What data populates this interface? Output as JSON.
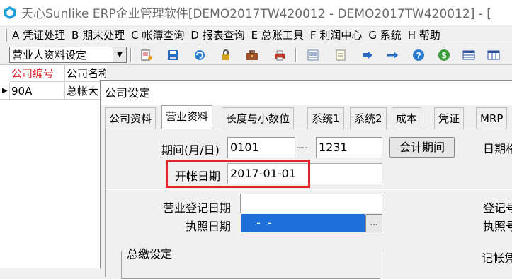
{
  "window": {
    "title": "天心Sunlike ERP企业管理软件[DEMO2017TW420012 - DEMO2017TW420012] - ["
  },
  "menu": [
    {
      "label": "A 凭证处理"
    },
    {
      "label": "B 期末处理"
    },
    {
      "label": "C 帐簿查询"
    },
    {
      "label": "D 报表查询"
    },
    {
      "label": "E 总账工具"
    },
    {
      "label": "F 利润中心"
    },
    {
      "label": "G 系统"
    },
    {
      "label": "H 帮助"
    }
  ],
  "toolbar": {
    "combo_value": "营业人资料设定",
    "combo_arrow": "▼",
    "icons": [
      "new-record-icon",
      "save-icon",
      "refresh-icon",
      "lock-icon",
      "briefcase-icon",
      "printer-icon",
      "list-view-icon",
      "note-icon",
      "export-icon",
      "help-icon",
      "currency-icon",
      "table-icon",
      "grid-icon"
    ]
  },
  "grid": {
    "columns": [
      {
        "label": "公司编号",
        "color": "#e0242b"
      },
      {
        "label": "公司名称",
        "color": "#000000"
      }
    ],
    "rows": [
      {
        "marker": "▶",
        "id": "90A",
        "name": "总帐大"
      }
    ]
  },
  "dialog": {
    "title": "公司设定",
    "tabs": [
      "公司资料",
      "营业资料",
      "长度与小数位",
      "系统1",
      "系统2",
      "成本",
      "凭证",
      "MRP"
    ],
    "active_tab": "营业资料",
    "form": {
      "period_label": "期间(月/日)",
      "period_start": "0101",
      "period_sep": "---",
      "period_end": "1231",
      "accounting_period_button": "会计期间",
      "date_label_right": "日期格",
      "open_date_label": "开帐日期",
      "open_date_value": "2017-01-01",
      "business_reg_date_label": "营业登记日期",
      "business_reg_date_value": "",
      "license_date_label": "执照日期",
      "license_date_value": "  -  -",
      "license_date_button": "...",
      "reg_label_right": "登记号",
      "license_label_right": "执照号",
      "payment_group_label": "总缴设定",
      "voucher_label_right": "记帐凭"
    },
    "highlight_color": "#e0242b"
  }
}
